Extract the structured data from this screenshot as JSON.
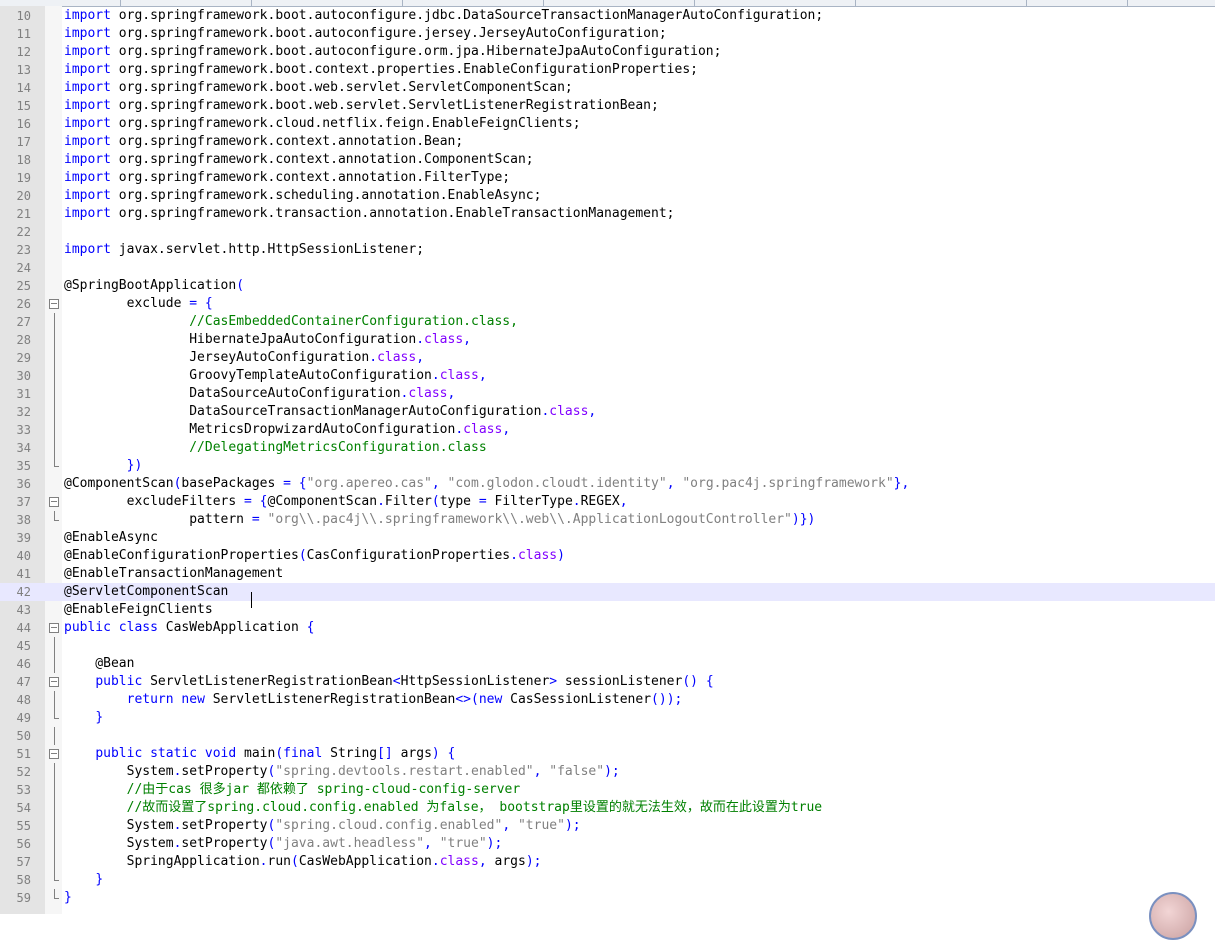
{
  "editor": {
    "tab_count": 9,
    "cursor_line": 42,
    "lines": [
      {
        "n": "10",
        "tokens": [
          [
            "kw",
            "import"
          ],
          [
            "t",
            " org.springframework.boot.autoconfigure.jdbc.DataSourceTransactionManagerAutoConfiguration;"
          ]
        ]
      },
      {
        "n": "11",
        "tokens": [
          [
            "kw",
            "import"
          ],
          [
            "t",
            " org.springframework.boot.autoconfigure.jersey.JerseyAutoConfiguration;"
          ]
        ]
      },
      {
        "n": "12",
        "tokens": [
          [
            "kw",
            "import"
          ],
          [
            "t",
            " org.springframework.boot.autoconfigure.orm.jpa.HibernateJpaAutoConfiguration;"
          ]
        ]
      },
      {
        "n": "13",
        "tokens": [
          [
            "kw",
            "import"
          ],
          [
            "t",
            " org.springframework.boot.context.properties.EnableConfigurationProperties;"
          ]
        ]
      },
      {
        "n": "14",
        "tokens": [
          [
            "kw",
            "import"
          ],
          [
            "t",
            " org.springframework.boot.web.servlet.ServletComponentScan;"
          ]
        ]
      },
      {
        "n": "15",
        "tokens": [
          [
            "kw",
            "import"
          ],
          [
            "t",
            " org.springframework.boot.web.servlet.ServletListenerRegistrationBean;"
          ]
        ]
      },
      {
        "n": "16",
        "tokens": [
          [
            "kw",
            "import"
          ],
          [
            "t",
            " org.springframework.cloud.netflix.feign.EnableFeignClients;"
          ]
        ]
      },
      {
        "n": "17",
        "tokens": [
          [
            "kw",
            "import"
          ],
          [
            "t",
            " org.springframework.context.annotation.Bean;"
          ]
        ]
      },
      {
        "n": "18",
        "tokens": [
          [
            "kw",
            "import"
          ],
          [
            "t",
            " org.springframework.context.annotation.ComponentScan;"
          ]
        ]
      },
      {
        "n": "19",
        "tokens": [
          [
            "kw",
            "import"
          ],
          [
            "t",
            " org.springframework.context.annotation.FilterType;"
          ]
        ]
      },
      {
        "n": "20",
        "tokens": [
          [
            "kw",
            "import"
          ],
          [
            "t",
            " org.springframework.scheduling.annotation.EnableAsync;"
          ]
        ]
      },
      {
        "n": "21",
        "tokens": [
          [
            "kw",
            "import"
          ],
          [
            "t",
            " org.springframework.transaction.annotation.EnableTransactionManagement;"
          ]
        ]
      },
      {
        "n": "22",
        "tokens": []
      },
      {
        "n": "23",
        "tokens": [
          [
            "kw",
            "import"
          ],
          [
            "t",
            " javax.servlet.http.HttpSessionListener;"
          ]
        ]
      },
      {
        "n": "24",
        "tokens": []
      },
      {
        "n": "25",
        "tokens": [
          [
            "t",
            "@SpringBootApplication"
          ],
          [
            "kw",
            "("
          ]
        ]
      },
      {
        "n": "26",
        "fold": "open",
        "tokens": [
          [
            "t",
            "        exclude "
          ],
          [
            "kw",
            "= {"
          ]
        ]
      },
      {
        "n": "27",
        "fold": "line",
        "tokens": [
          [
            "t",
            "                "
          ],
          [
            "cm",
            "//CasEmbeddedContainerConfiguration.class,"
          ]
        ]
      },
      {
        "n": "28",
        "fold": "line",
        "tokens": [
          [
            "t",
            "                HibernateJpaAutoConfiguration"
          ],
          [
            "kw",
            "."
          ],
          [
            "pu",
            "class"
          ],
          [
            "kw",
            ","
          ]
        ]
      },
      {
        "n": "29",
        "fold": "line",
        "tokens": [
          [
            "t",
            "                JerseyAutoConfiguration"
          ],
          [
            "kw",
            "."
          ],
          [
            "pu",
            "class"
          ],
          [
            "kw",
            ","
          ]
        ]
      },
      {
        "n": "30",
        "fold": "line",
        "tokens": [
          [
            "t",
            "                GroovyTemplateAutoConfiguration"
          ],
          [
            "kw",
            "."
          ],
          [
            "pu",
            "class"
          ],
          [
            "kw",
            ","
          ]
        ]
      },
      {
        "n": "31",
        "fold": "line",
        "tokens": [
          [
            "t",
            "                DataSourceAutoConfiguration"
          ],
          [
            "kw",
            "."
          ],
          [
            "pu",
            "class"
          ],
          [
            "kw",
            ","
          ]
        ]
      },
      {
        "n": "32",
        "fold": "line",
        "tokens": [
          [
            "t",
            "                DataSourceTransactionManagerAutoConfiguration"
          ],
          [
            "kw",
            "."
          ],
          [
            "pu",
            "class"
          ],
          [
            "kw",
            ","
          ]
        ]
      },
      {
        "n": "33",
        "fold": "line",
        "tokens": [
          [
            "t",
            "                MetricsDropwizardAutoConfiguration"
          ],
          [
            "kw",
            "."
          ],
          [
            "pu",
            "class"
          ],
          [
            "kw",
            ","
          ]
        ]
      },
      {
        "n": "34",
        "fold": "line",
        "tokens": [
          [
            "t",
            "                "
          ],
          [
            "cm",
            "//DelegatingMetricsConfiguration.class"
          ]
        ]
      },
      {
        "n": "35",
        "fold": "end",
        "tokens": [
          [
            "t",
            "        "
          ],
          [
            "kw",
            "})"
          ]
        ]
      },
      {
        "n": "36",
        "tokens": [
          [
            "t",
            "@ComponentScan"
          ],
          [
            "kw",
            "("
          ],
          [
            "t",
            "basePackages "
          ],
          [
            "kw",
            "= {"
          ],
          [
            "st",
            "\"org.apereo.cas\""
          ],
          [
            "kw",
            ", "
          ],
          [
            "st",
            "\"com.glodon.cloudt.identity\""
          ],
          [
            "kw",
            ", "
          ],
          [
            "st",
            "\"org.pac4j.springframework\""
          ],
          [
            "kw",
            "},"
          ]
        ]
      },
      {
        "n": "37",
        "fold": "open",
        "tokens": [
          [
            "t",
            "        excludeFilters "
          ],
          [
            "kw",
            "= {"
          ],
          [
            "t",
            "@ComponentScan"
          ],
          [
            "kw",
            "."
          ],
          [
            "t",
            "Filter"
          ],
          [
            "kw",
            "("
          ],
          [
            "t",
            "type "
          ],
          [
            "kw",
            "="
          ],
          [
            "t",
            " FilterType"
          ],
          [
            "kw",
            "."
          ],
          [
            "t",
            "REGEX"
          ],
          [
            "kw",
            ","
          ]
        ]
      },
      {
        "n": "38",
        "fold": "end",
        "tokens": [
          [
            "t",
            "                pattern "
          ],
          [
            "kw",
            "= "
          ],
          [
            "st",
            "\"org\\\\.pac4j\\\\.springframework\\\\.web\\\\.ApplicationLogoutController\""
          ],
          [
            "kw",
            ")})"
          ]
        ]
      },
      {
        "n": "39",
        "tokens": [
          [
            "t",
            "@EnableAsync"
          ]
        ]
      },
      {
        "n": "40",
        "tokens": [
          [
            "t",
            "@EnableConfigurationProperties"
          ],
          [
            "kw",
            "("
          ],
          [
            "t",
            "CasConfigurationProperties"
          ],
          [
            "kw",
            "."
          ],
          [
            "pu",
            "class"
          ],
          [
            "kw",
            ")"
          ]
        ]
      },
      {
        "n": "41",
        "tokens": [
          [
            "t",
            "@EnableTransactionManagement"
          ]
        ]
      },
      {
        "n": "42",
        "tokens": [
          [
            "t",
            "@ServletComponentScan"
          ]
        ]
      },
      {
        "n": "43",
        "tokens": [
          [
            "t",
            "@EnableFeignClients"
          ]
        ]
      },
      {
        "n": "44",
        "fold": "open",
        "tokens": [
          [
            "kw",
            "public"
          ],
          [
            "t",
            " "
          ],
          [
            "kw",
            "class"
          ],
          [
            "t",
            " CasWebApplication "
          ],
          [
            "kw",
            "{"
          ]
        ]
      },
      {
        "n": "45",
        "fold": "line",
        "tokens": []
      },
      {
        "n": "46",
        "fold": "line",
        "tokens": [
          [
            "t",
            "    @Bean"
          ]
        ]
      },
      {
        "n": "47",
        "fold": "open",
        "tokens": [
          [
            "t",
            "    "
          ],
          [
            "kw",
            "public"
          ],
          [
            "t",
            " ServletListenerRegistrationBean"
          ],
          [
            "kw",
            "<"
          ],
          [
            "t",
            "HttpSessionListener"
          ],
          [
            "kw",
            ">"
          ],
          [
            "t",
            " sessionListener"
          ],
          [
            "kw",
            "() {"
          ]
        ]
      },
      {
        "n": "48",
        "fold": "line",
        "tokens": [
          [
            "t",
            "        "
          ],
          [
            "kw",
            "return new"
          ],
          [
            "t",
            " ServletListenerRegistrationBean"
          ],
          [
            "kw",
            "<>("
          ],
          [
            "kw",
            "new"
          ],
          [
            "t",
            " CasSessionListener"
          ],
          [
            "kw",
            "());"
          ]
        ]
      },
      {
        "n": "49",
        "fold": "end",
        "tokens": [
          [
            "t",
            "    "
          ],
          [
            "kw",
            "}"
          ]
        ]
      },
      {
        "n": "50",
        "fold": "line",
        "tokens": []
      },
      {
        "n": "51",
        "fold": "open",
        "tokens": [
          [
            "t",
            "    "
          ],
          [
            "kw",
            "public static void"
          ],
          [
            "t",
            " main"
          ],
          [
            "kw",
            "("
          ],
          [
            "kw",
            "final"
          ],
          [
            "t",
            " String"
          ],
          [
            "kw",
            "[]"
          ],
          [
            "t",
            " args"
          ],
          [
            "kw",
            ") {"
          ]
        ]
      },
      {
        "n": "52",
        "fold": "line",
        "tokens": [
          [
            "t",
            "        System"
          ],
          [
            "kw",
            "."
          ],
          [
            "t",
            "setProperty"
          ],
          [
            "kw",
            "("
          ],
          [
            "st",
            "\"spring.devtools.restart.enabled\""
          ],
          [
            "kw",
            ", "
          ],
          [
            "st",
            "\"false\""
          ],
          [
            "kw",
            ");"
          ]
        ]
      },
      {
        "n": "53",
        "fold": "line",
        "tokens": [
          [
            "t",
            "        "
          ],
          [
            "cm",
            "//由于cas 很多jar 都依赖了 spring-cloud-config-server"
          ]
        ]
      },
      {
        "n": "54",
        "fold": "line",
        "tokens": [
          [
            "t",
            "        "
          ],
          [
            "cm",
            "//故而设置了spring.cloud.config.enabled 为false， bootstrap里设置的就无法生效，故而在此设置为true"
          ]
        ]
      },
      {
        "n": "55",
        "fold": "line",
        "tokens": [
          [
            "t",
            "        System"
          ],
          [
            "kw",
            "."
          ],
          [
            "t",
            "setProperty"
          ],
          [
            "kw",
            "("
          ],
          [
            "st",
            "\"spring.cloud.config.enabled\""
          ],
          [
            "kw",
            ", "
          ],
          [
            "st",
            "\"true\""
          ],
          [
            "kw",
            ");"
          ]
        ]
      },
      {
        "n": "56",
        "fold": "line",
        "tokens": [
          [
            "t",
            "        System"
          ],
          [
            "kw",
            "."
          ],
          [
            "t",
            "setProperty"
          ],
          [
            "kw",
            "("
          ],
          [
            "st",
            "\"java.awt.headless\""
          ],
          [
            "kw",
            ", "
          ],
          [
            "st",
            "\"true\""
          ],
          [
            "kw",
            ");"
          ]
        ]
      },
      {
        "n": "57",
        "fold": "line",
        "tokens": [
          [
            "t",
            "        SpringApplication"
          ],
          [
            "kw",
            "."
          ],
          [
            "t",
            "run"
          ],
          [
            "kw",
            "("
          ],
          [
            "t",
            "CasWebApplication"
          ],
          [
            "kw",
            "."
          ],
          [
            "pu",
            "class"
          ],
          [
            "kw",
            ","
          ],
          [
            "t",
            " args"
          ],
          [
            "kw",
            ");"
          ]
        ]
      },
      {
        "n": "58",
        "fold": "end",
        "tokens": [
          [
            "t",
            "    "
          ],
          [
            "kw",
            "}"
          ]
        ]
      },
      {
        "n": "59",
        "fold": "end",
        "tokens": [
          [
            "kw",
            "}"
          ]
        ]
      }
    ]
  }
}
